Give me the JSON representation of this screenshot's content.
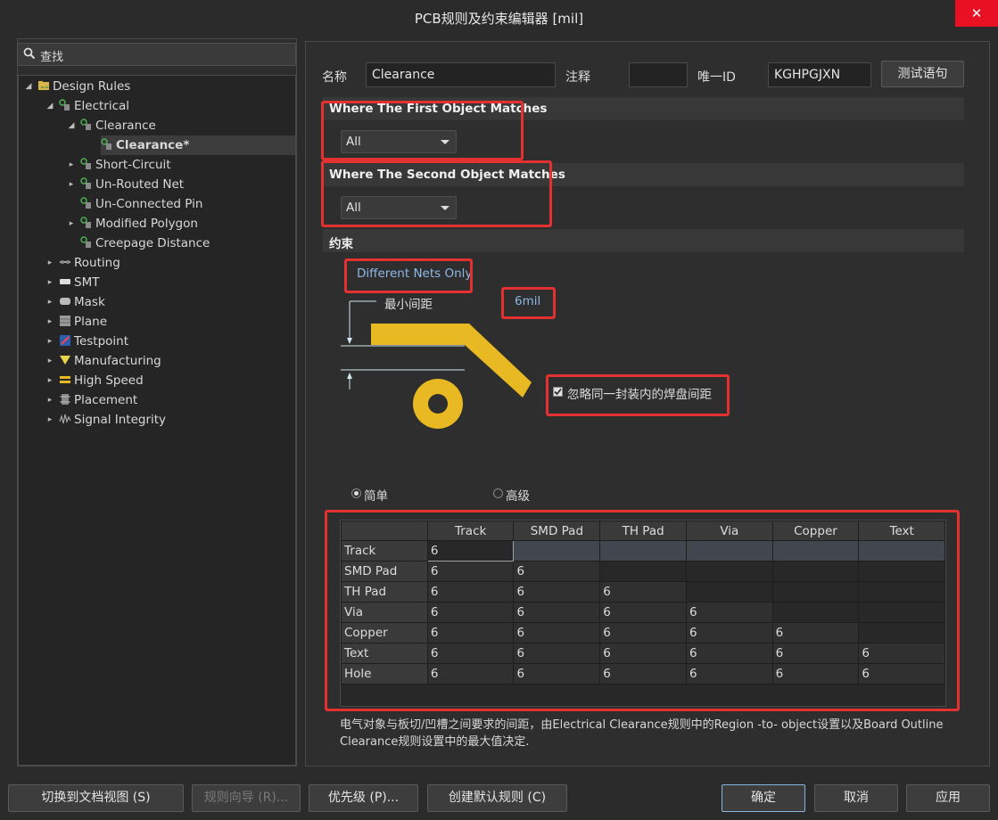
{
  "window": {
    "title": "PCB规则及约束编辑器 [mil]",
    "close": "✕"
  },
  "search": {
    "label": "查找"
  },
  "tree": [
    {
      "label": "Design Rules",
      "arrow": "◢"
    },
    {
      "label": "Electrical",
      "arrow": "◢"
    },
    {
      "label": "Clearance",
      "arrow": "◢"
    },
    {
      "label": "Clearance*",
      "arrow": ""
    },
    {
      "label": "Short-Circuit",
      "arrow": "▸"
    },
    {
      "label": "Un-Routed Net",
      "arrow": "▸"
    },
    {
      "label": "Un-Connected Pin",
      "arrow": ""
    },
    {
      "label": "Modified Polygon",
      "arrow": "▸"
    },
    {
      "label": "Creepage Distance",
      "arrow": ""
    },
    {
      "label": "Routing",
      "arrow": "▸"
    },
    {
      "label": "SMT",
      "arrow": "▸"
    },
    {
      "label": "Mask",
      "arrow": "▸"
    },
    {
      "label": "Plane",
      "arrow": "▸"
    },
    {
      "label": "Testpoint",
      "arrow": "▸"
    },
    {
      "label": "Manufacturing",
      "arrow": "▸"
    },
    {
      "label": "High Speed",
      "arrow": "▸"
    },
    {
      "label": "Placement",
      "arrow": "▸"
    },
    {
      "label": "Signal Integrity",
      "arrow": "▸"
    }
  ],
  "rule": {
    "name_label": "名称",
    "name_value": "Clearance",
    "comment_label": "注释",
    "comment_value": "",
    "uid_label": "唯一ID",
    "uid_value": "KGHPGJXN",
    "test_button": "测试语句"
  },
  "first_match": {
    "title": "Where The First Object Matches",
    "selected": "All"
  },
  "second_match": {
    "title": "Where The Second Object Matches",
    "selected": "All"
  },
  "constraints": {
    "title": "约束",
    "net_scope": "Different Nets Only",
    "min_clearance_label": "最小间距",
    "min_clearance_value": "6mil",
    "ignore_pads_label": "忽略同一封装内的焊盘间距",
    "ignore_pads_checked": true,
    "mode_simple": "简单",
    "mode_advanced": "高级",
    "mode_selected": "简单"
  },
  "grid": {
    "columns": [
      "",
      "Track",
      "SMD Pad",
      "TH Pad",
      "Via",
      "Copper",
      "Text"
    ],
    "rows": [
      {
        "label": "Track",
        "values": [
          "6",
          "",
          "",
          "",
          "",
          ""
        ]
      },
      {
        "label": "SMD Pad",
        "values": [
          "6",
          "6",
          "",
          "",
          "",
          ""
        ]
      },
      {
        "label": "TH Pad",
        "values": [
          "6",
          "6",
          "6",
          "",
          "",
          ""
        ]
      },
      {
        "label": "Via",
        "values": [
          "6",
          "6",
          "6",
          "6",
          "",
          ""
        ]
      },
      {
        "label": "Copper",
        "values": [
          "6",
          "6",
          "6",
          "6",
          "6",
          ""
        ]
      },
      {
        "label": "Text",
        "values": [
          "6",
          "6",
          "6",
          "6",
          "6",
          "6"
        ]
      },
      {
        "label": "Hole",
        "values": [
          "6",
          "6",
          "6",
          "6",
          "6",
          "6"
        ]
      }
    ]
  },
  "description": "电气对象与板切/凹槽之间要求的间距，由Electrical Clearance规则中的Region -to- object设置以及Board Outline Clearance规则设置中的最大值决定.",
  "buttons": {
    "doc_view": "切换到文档视图 (S)",
    "wizard": "规则向导 (R)...",
    "priority": "优先级 (P)...",
    "create_default": "创建默认规则 (C)",
    "ok": "确定",
    "cancel": "取消",
    "apply": "应用"
  },
  "colors": {
    "accent_red": "#e33030",
    "copper_yellow": "#e8b923",
    "link_blue": "#8db8e8"
  }
}
